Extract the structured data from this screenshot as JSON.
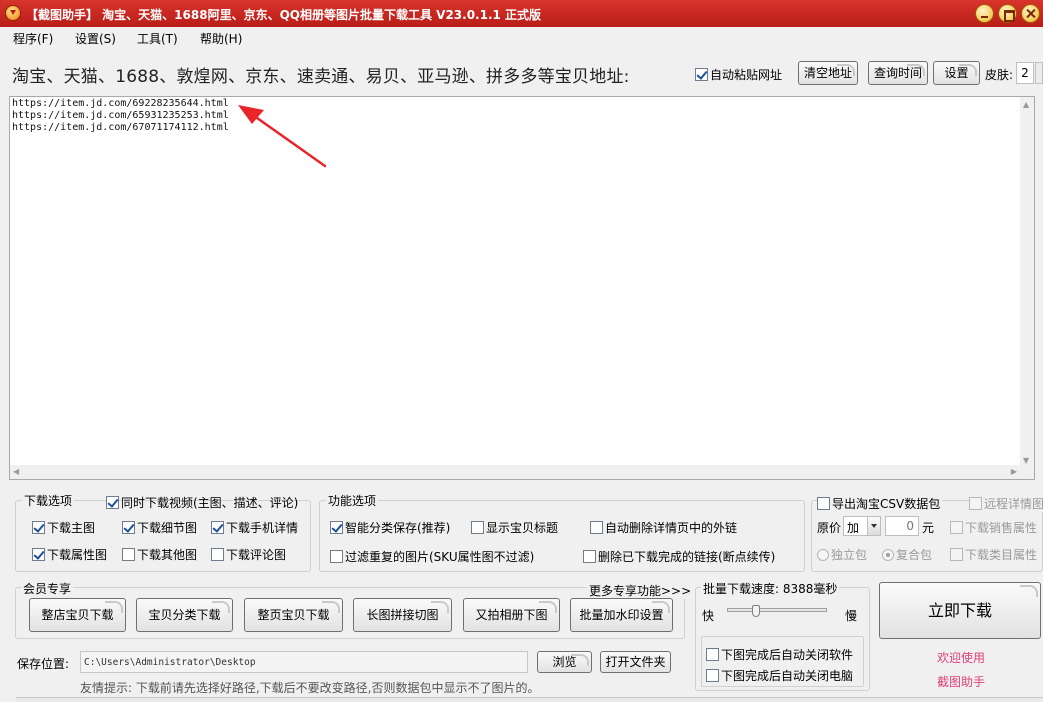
{
  "window": {
    "title": "【截图助手】 淘宝、天猫、1688阿里、京东、QQ相册等图片批量下载工具 V23.0.1.1 正式版"
  },
  "menu": [
    {
      "label": "程序(F)"
    },
    {
      "label": "设置(S)"
    },
    {
      "label": "工具(T)"
    },
    {
      "label": "帮助(H)"
    }
  ],
  "url_section": {
    "heading": "淘宝、天猫、1688、敦煌网、京东、速卖通、易贝、亚马逊、拼多多等宝贝地址:",
    "auto_paste_label": "自动粘贴网址",
    "auto_paste_checked": true,
    "clear_button": "清空地址",
    "query_time_button": "查询时间",
    "settings_button": "设置",
    "skin_label": "皮肤:",
    "skin_value": "2",
    "urls": [
      "https://item.jd.com/69228235644.html",
      "https://item.jd.com/65931235253.html",
      "https://item.jd.com/67071174112.html"
    ]
  },
  "download_options": {
    "title": "下载选项",
    "video": {
      "label": "同时下载视频(主图、描述、评论)",
      "checked": true
    },
    "items": [
      {
        "label": "下载主图",
        "checked": true
      },
      {
        "label": "下载细节图",
        "checked": true
      },
      {
        "label": "下载手机详情",
        "checked": true
      },
      {
        "label": "下载属性图",
        "checked": true
      },
      {
        "label": "下载其他图",
        "checked": false
      },
      {
        "label": "下载评论图",
        "checked": false
      }
    ]
  },
  "feature_options": {
    "title": "功能选项",
    "items": [
      {
        "label": "智能分类保存(推荐)",
        "checked": true
      },
      {
        "label": "显示宝贝标题",
        "checked": false
      },
      {
        "label": "自动删除详情页中的外链",
        "checked": false
      },
      {
        "label": "过滤重复的图片(SKU属性图不过滤)",
        "checked": false
      },
      {
        "label": "删除已下载完成的链接(断点续传)",
        "checked": false
      }
    ]
  },
  "csv_options": {
    "export_label": "导出淘宝CSV数据包",
    "remote_detail_label": "远程详情图",
    "price_label": "原价",
    "price_op": "加",
    "price_value": "0",
    "price_unit": "元",
    "sales_label": "下载销售属性",
    "independent_label": "独立包",
    "combined_label": "复合包",
    "category_label": "下载类目属性"
  },
  "member": {
    "title": "会员专享",
    "more_link": "更多专享功能>>>",
    "buttons": [
      "整店宝贝下载",
      "宝贝分类下载",
      "整页宝贝下载",
      "长图拼接切图",
      "又拍相册下图",
      "批量加水印设置"
    ]
  },
  "speed": {
    "label": "批量下载速度: 8388毫秒",
    "fast": "快",
    "slow": "慢",
    "slider_fraction": 0.29,
    "close_software": "下图完成后自动关闭软件",
    "close_computer": "下图完成后自动关闭电脑"
  },
  "download_button": "立即下载",
  "welcome": {
    "line1": "欢迎使用",
    "line2": "截图助手"
  },
  "save": {
    "label": "保存位置:",
    "path": "C:\\Users\\Administrator\\Desktop",
    "browse_button": "浏览",
    "open_folder_button": "打开文件夹",
    "tip": "友情提示: 下载前请先选择好路径,下载后不要改变路径,否则数据包中显示不了图片的。"
  },
  "colors": {
    "titlebar": "#c8271f",
    "annotation_arrow": "#e8262a",
    "welcome_link": "#e0407a"
  }
}
